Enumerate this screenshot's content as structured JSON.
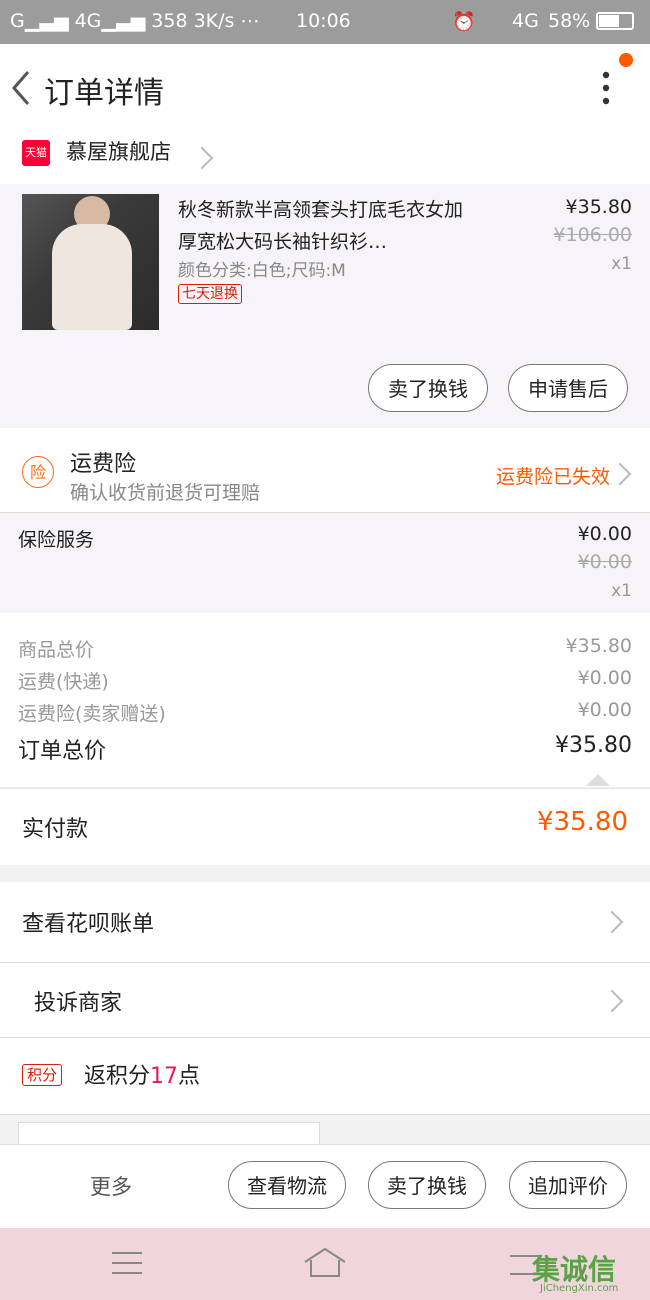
{
  "status_bar": {
    "left": "G▁▃▅ 4G▁▃▅ 358 3K/s ⋯",
    "time": "10:06",
    "battery": "58%",
    "network": "4G"
  },
  "header": {
    "title": "订单详情"
  },
  "store": {
    "badge": "天猫",
    "name": "慕屋旗舰店"
  },
  "product": {
    "title": "秋冬新款半高领套头打底毛衣女加厚宽松大码长袖针织衫…",
    "props": "颜色分类:白色;尺码:M",
    "badge": "七天退换",
    "price": "¥35.80",
    "original_price": "¥106.00",
    "qty": "x1",
    "btn_resell": "卖了换钱",
    "btn_aftersale": "申请售后"
  },
  "insurance": {
    "icon_text": "险",
    "title": "运费险",
    "subtitle": "确认收货前退货可理赔",
    "status": "运费险已失效"
  },
  "service": {
    "label": "保险服务",
    "price": "¥0.00",
    "original_price": "¥0.00",
    "qty": "x1"
  },
  "totals": {
    "goods_label": "商品总价",
    "goods_value": "¥35.80",
    "shipping_label": "运费(快递)",
    "shipping_value": "¥0.00",
    "insurance_label": "运费险(卖家赠送)",
    "insurance_value": "¥0.00",
    "order_total_label": "订单总价",
    "order_total_value": "¥35.80"
  },
  "paid": {
    "label": "实付款",
    "value": "¥35.80"
  },
  "links": {
    "huabei": "查看花呗账单",
    "complaint": "投诉商家"
  },
  "points": {
    "badge": "积分",
    "prefix": "返积分",
    "count": "17",
    "suffix": "点"
  },
  "actions": {
    "more": "更多",
    "logistics": "查看物流",
    "resell": "卖了换钱",
    "review": "追加评价"
  },
  "watermark": {
    "text": "集诚信",
    "sub": "JiChengXin.com"
  },
  "colors": {
    "accent": "#ff5a00",
    "tmall": "#ff0036",
    "points": "#e8175d"
  }
}
